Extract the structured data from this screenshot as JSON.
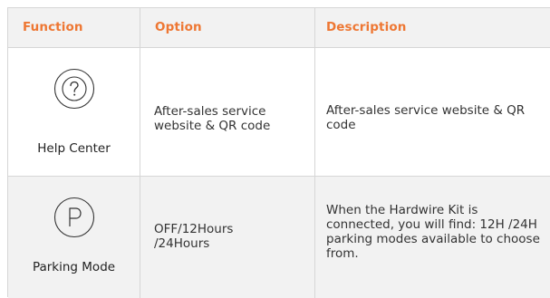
{
  "headers": {
    "function": "Function",
    "option": "Option",
    "description": "Description"
  },
  "rows": [
    {
      "function_label": "Help Center",
      "icon": "help-question-icon",
      "option": "After-sales service\nwebsite & QR code",
      "description": "After-sales service website & QR\ncode"
    },
    {
      "function_label": "Parking Mode",
      "icon": "parking-p-icon",
      "option": "OFF/12Hours\n/24Hours",
      "description": "When the Hardwire Kit is\nconnected, you will find: 12H /24H\nparking modes available to choose\nfrom."
    }
  ],
  "colors": {
    "header_text": "#ee7733",
    "header_bg": "#f2f2f2",
    "border": "#d6d6d6"
  }
}
